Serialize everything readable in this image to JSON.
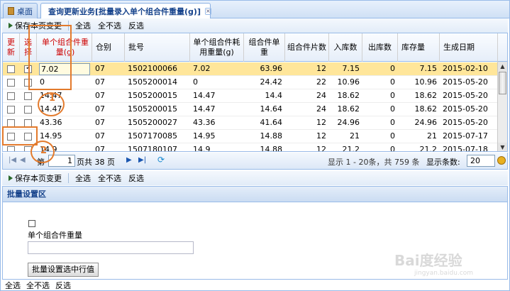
{
  "tabs": {
    "home_label": "桌面",
    "active_label": "查询更新业务[批量录入单个组合件重量(g)]",
    "close_glyph": "×"
  },
  "toolbar": {
    "save_label": "保存本页变更",
    "select_all_label": "全选",
    "select_none_label": "全不选",
    "invert_label": "反选"
  },
  "grid": {
    "columns": [
      "更新",
      "选择",
      "单个组合件重量(g)",
      "仓别",
      "批号",
      "单个组合件耗用重量(g)",
      "组合件单重",
      "组合件片数",
      "入库数",
      "出库数",
      "库存量",
      "生成日期"
    ],
    "rows": [
      {
        "update": false,
        "select": true,
        "weight": "7.02",
        "warehouse": "07",
        "batch": "1502100066",
        "used_weight": "7.02",
        "unit_weight": "63.96",
        "pieces": "12",
        "in_qty": "7.15",
        "out_qty": "0",
        "stock": "7.15",
        "date": "2015-02-10"
      },
      {
        "update": false,
        "select": false,
        "weight": "0",
        "warehouse": "07",
        "batch": "1505200014",
        "used_weight": "0",
        "unit_weight": "24.42",
        "pieces": "22",
        "in_qty": "10.96",
        "out_qty": "0",
        "stock": "10.96",
        "date": "2015-05-20"
      },
      {
        "update": false,
        "select": false,
        "weight": "14.47",
        "warehouse": "07",
        "batch": "1505200015",
        "used_weight": "14.47",
        "unit_weight": "14.4",
        "pieces": "24",
        "in_qty": "18.62",
        "out_qty": "0",
        "stock": "18.62",
        "date": "2015-05-20"
      },
      {
        "update": false,
        "select": false,
        "weight": "14.47",
        "warehouse": "07",
        "batch": "1505200015",
        "used_weight": "14.47",
        "unit_weight": "14.64",
        "pieces": "24",
        "in_qty": "18.62",
        "out_qty": "0",
        "stock": "18.62",
        "date": "2015-05-20"
      },
      {
        "update": false,
        "select": false,
        "weight": "43.36",
        "warehouse": "07",
        "batch": "1505200027",
        "used_weight": "43.36",
        "unit_weight": "41.64",
        "pieces": "12",
        "in_qty": "24.96",
        "out_qty": "0",
        "stock": "24.96",
        "date": "2015-05-20"
      },
      {
        "update": false,
        "select": false,
        "weight": "14.95",
        "warehouse": "07",
        "batch": "1507170085",
        "used_weight": "14.95",
        "unit_weight": "14.88",
        "pieces": "12",
        "in_qty": "21",
        "out_qty": "0",
        "stock": "21",
        "date": "2015-07-17"
      },
      {
        "update": false,
        "select": false,
        "weight": "14.9",
        "warehouse": "07",
        "batch": "1507180107",
        "used_weight": "14.9",
        "unit_weight": "14.88",
        "pieces": "12",
        "in_qty": "21.2",
        "out_qty": "0",
        "stock": "21.2",
        "date": "2015-07-18"
      }
    ]
  },
  "pager": {
    "page_prefix": "第",
    "page_value": "1",
    "page_suffix": "页共 38 页",
    "display_info": "显示 1 - 20条，共 759 条",
    "page_size_label": "显示条数:",
    "page_size_value": "20"
  },
  "batch": {
    "title": "批量设置区",
    "field_label": "单个组合件重量",
    "field_value": "",
    "apply_label": "批量设置选中行值"
  },
  "bottom": {
    "select_all_label": "全选",
    "select_none_label": "全不选",
    "invert_label": "反选"
  },
  "annotations": [
    "1",
    "2"
  ],
  "watermark": {
    "text": "Bai度经验",
    "sub": "jingyan.baidu.com"
  },
  "colors": {
    "accent": "#15428b",
    "header_red": "#cc0000",
    "selected_row": "#ffe69a",
    "annotation": "#e37a2c"
  }
}
